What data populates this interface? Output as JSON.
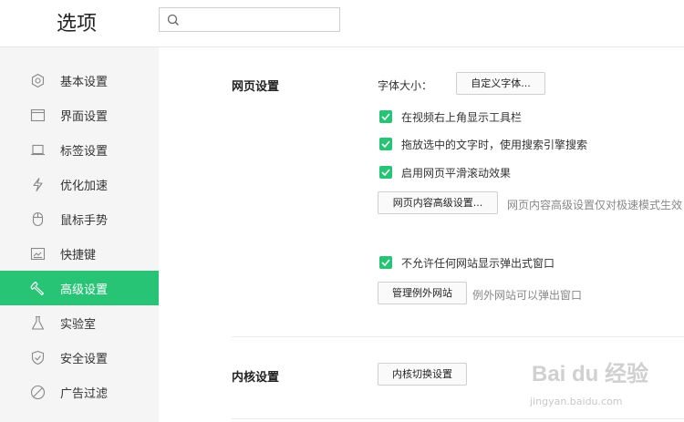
{
  "header": {
    "title": "选项",
    "search_placeholder": ""
  },
  "sidebar": {
    "items": [
      {
        "label": "基本设置",
        "icon": "gear-icon"
      },
      {
        "label": "界面设置",
        "icon": "window-icon"
      },
      {
        "label": "标签设置",
        "icon": "tab-icon"
      },
      {
        "label": "优化加速",
        "icon": "lightning-icon"
      },
      {
        "label": "鼠标手势",
        "icon": "mouse-icon"
      },
      {
        "label": "快捷键",
        "icon": "keyboard-icon"
      },
      {
        "label": "高级设置",
        "icon": "wrench-icon",
        "active": true
      },
      {
        "label": "实验室",
        "icon": "flask-icon"
      },
      {
        "label": "安全设置",
        "icon": "shield-icon"
      },
      {
        "label": "广告过滤",
        "icon": "block-icon"
      }
    ]
  },
  "web_settings": {
    "title": "网页设置",
    "font_size_label": "字体大小：",
    "custom_font_button": "自定义字体...",
    "options": [
      {
        "label": "在视频右上角显示工具栏",
        "checked": true
      },
      {
        "label": "拖放选中的文字时，使用搜索引擎搜索",
        "checked": true
      },
      {
        "label": "启用网页平滑滚动效果",
        "checked": true
      }
    ],
    "advanced_button": "网页内容高级设置...",
    "advanced_hint": "网页内容高级设置仅对极速模式生效",
    "popup_option": {
      "label": "不允许任何网站显示弹出式窗口",
      "checked": true
    },
    "exceptions_button": "管理例外网站",
    "exceptions_hint": "例外网站可以弹出窗口"
  },
  "kernel_settings": {
    "title": "内核设置",
    "switch_button": "内核切换设置"
  },
  "watermark": {
    "main": "Bai du 经验",
    "sub": "jingyan.baidu.com"
  },
  "colors": {
    "accent": "#27c476",
    "sidebar_bg": "#f5f5f5"
  }
}
